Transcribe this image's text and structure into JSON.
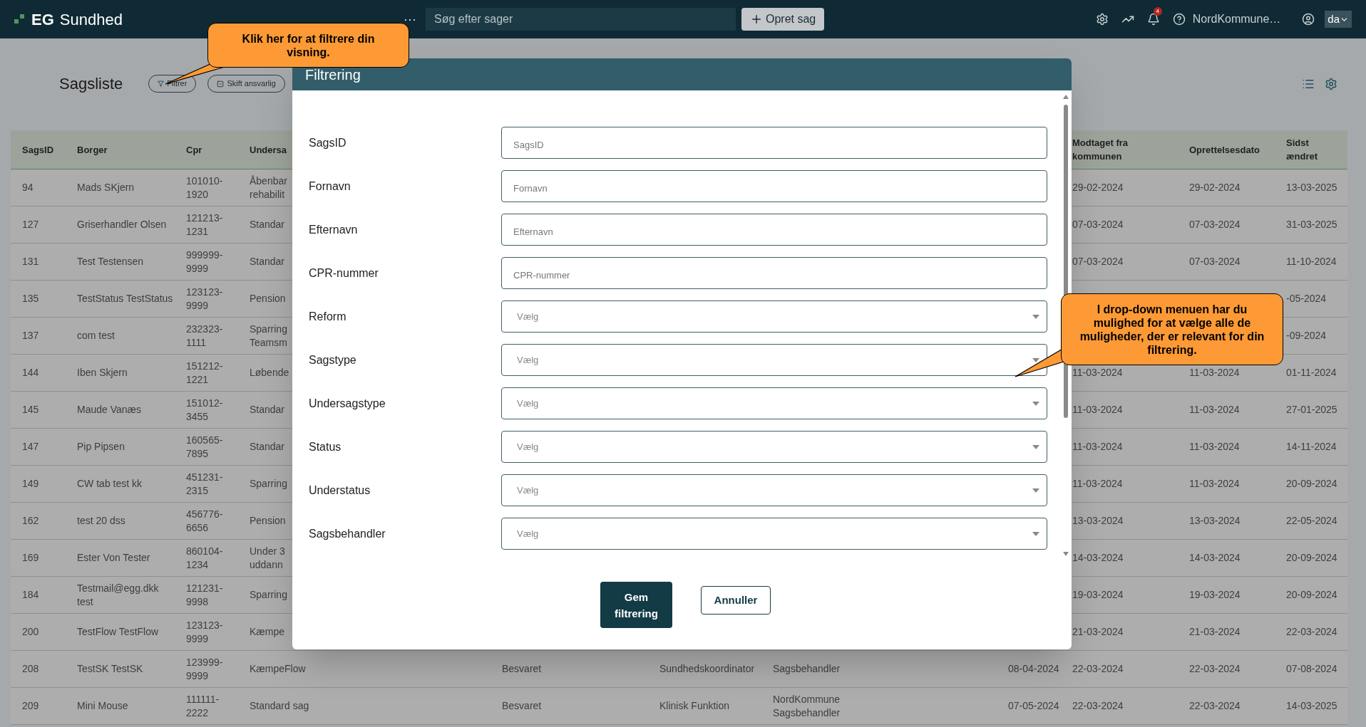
{
  "topbar": {
    "logo_mark": "EG",
    "logo_text": "Sundhed",
    "more": "⋯",
    "search_placeholder": "Søg efter sager",
    "create_button": "Opret sag",
    "notifications_badge": "4",
    "organization": "NordKommune…",
    "language": "da"
  },
  "page": {
    "title": "Sagsliste",
    "buttons": [
      {
        "label": "Filtrer"
      },
      {
        "label": "Skift ansvarlig"
      }
    ]
  },
  "table": {
    "columns": {
      "sagsid": "SagsID",
      "borger": "Borger",
      "cpr": "Cpr",
      "column_4": "Undersa",
      "modtaget": "Modtaget fra kommunen",
      "oprettelse": "Oprettelsesdato",
      "sidst": "Sidst ændret"
    },
    "rows": [
      {
        "sagsid": "94",
        "borger": "Mads SKjern",
        "cpr": "101010-1920",
        "column_4": "Åbenbar rehabilit",
        "modtaget": "29-02-2024",
        "oprettelse": "29-02-2024",
        "sidst": "13-03-2025"
      },
      {
        "sagsid": "127",
        "borger": "Griserhandler Olsen",
        "cpr": "121213-1231",
        "column_4": "Standar",
        "modtaget": "07-03-2024",
        "oprettelse": "07-03-2024",
        "sidst": "31-03-2025"
      },
      {
        "sagsid": "131",
        "borger": "Test Testensen",
        "cpr": "999999-9999",
        "column_4": "Standar",
        "modtaget": "07-03-2024",
        "oprettelse": "07-03-2024",
        "sidst": "11-10-2024"
      },
      {
        "sagsid": "135",
        "borger": "TestStatus TestStatus",
        "cpr": "123123-9999",
        "column_4": "Pension",
        "sidst": "-05-2024"
      },
      {
        "sagsid": "137",
        "borger": "com test",
        "cpr": "232323-1111",
        "column_4": "Sparring Teamsm",
        "sidst": "-09-2024"
      },
      {
        "sagsid": "144",
        "borger": "Iben Skjern",
        "cpr": "151212-1221",
        "column_4": "Løbende",
        "modtaget": "11-03-2024",
        "oprettelse": "11-03-2024",
        "sidst": "01-11-2024"
      },
      {
        "sagsid": "145",
        "borger": "Maude Vanæs",
        "cpr": "151012-3455",
        "column_4": "Standar",
        "modtaget": "11-03-2024",
        "oprettelse": "11-03-2024",
        "sidst": "27-01-2025"
      },
      {
        "sagsid": "147",
        "borger": "Pip Pipsen",
        "cpr": "160565-7895",
        "column_4": "Standar",
        "modtaget": "11-03-2024",
        "oprettelse": "11-03-2024",
        "sidst": "14-11-2024"
      },
      {
        "sagsid": "149",
        "borger": "CW tab test kk",
        "cpr": "451231-2315",
        "column_4": "Sparring",
        "modtaget": "11-03-2024",
        "oprettelse": "11-03-2024",
        "sidst": "20-09-2024"
      },
      {
        "sagsid": "162",
        "borger": "test 20 dss",
        "cpr": "456776-6656",
        "column_4": "Pension",
        "modtaget": "13-03-2024",
        "oprettelse": "13-03-2024",
        "sidst": "22-05-2024"
      },
      {
        "sagsid": "169",
        "borger": "Ester Von Tester",
        "cpr": "860104-1234",
        "column_4": "Under 3 uddann",
        "modtaget": "14-03-2024",
        "oprettelse": "14-03-2024",
        "sidst": "20-09-2024"
      },
      {
        "sagsid": "184",
        "borger": "Testmail@egg.dkk test",
        "cpr": "121231-9998",
        "column_4": "Sparring",
        "modtaget": "19-03-2024",
        "oprettelse": "19-03-2024",
        "sidst": "20-09-2024"
      },
      {
        "sagsid": "200",
        "borger": "TestFlow TestFlow",
        "cpr": "123123-9999",
        "column_4": "Kæmpe",
        "modtaget": "21-03-2024",
        "oprettelse": "21-03-2024",
        "sidst": "22-03-2024"
      },
      {
        "sagsid": "208",
        "borger": "TestSK TestSK",
        "cpr": "123999-9999",
        "column_4": "KæmpeFlow",
        "column_5": "Besvaret",
        "column_6": "Sundhedskoordinator",
        "column_7": "Sagsbehandler",
        "column_8": "08-04-2024",
        "modtaget": "22-03-2024",
        "oprettelse": "22-03-2024",
        "sidst": "07-08-2024"
      },
      {
        "sagsid": "209",
        "borger": "Mini Mouse",
        "cpr": "111111-2222",
        "column_4": "Standard sag",
        "column_5": "Besvaret",
        "column_6": "Klinisk Funktion",
        "column_7": "NordKommune Sagsbehandler",
        "column_8": "07-05-2024",
        "modtaget": "22-03-2024",
        "oprettelse": "22-03-2024",
        "sidst": "14-03-2025"
      }
    ]
  },
  "modal": {
    "title": "Filtrering",
    "fields": [
      {
        "kind": "text",
        "label": "SagsID",
        "placeholder": "SagsID"
      },
      {
        "kind": "text",
        "label": "Fornavn",
        "placeholder": "Fornavn"
      },
      {
        "kind": "text",
        "label": "Efternavn",
        "placeholder": "Efternavn"
      },
      {
        "kind": "text",
        "label": "CPR-nummer",
        "placeholder": "CPR-nummer"
      },
      {
        "kind": "select",
        "label": "Reform",
        "placeholder": "Vælg"
      },
      {
        "kind": "select",
        "label": "Sagstype",
        "placeholder": "Vælg"
      },
      {
        "kind": "select",
        "label": "Undersagstype",
        "placeholder": "Vælg"
      },
      {
        "kind": "select",
        "label": "Status",
        "placeholder": "Vælg"
      },
      {
        "kind": "select",
        "label": "Understatus",
        "placeholder": "Vælg"
      },
      {
        "kind": "select",
        "label": "Sagsbehandler",
        "placeholder": "Vælg"
      }
    ],
    "buttons": [
      {
        "kind": "primary",
        "label": "Gem filtrering"
      },
      {
        "kind": "secondary",
        "label": "Annuller"
      }
    ]
  },
  "callouts": [
    {
      "text": "Klik her for at filtrere din visning."
    },
    {
      "text": "I drop-down menuen har du mulighed for at vælge alle de muligheder, der er relevant for din filtrering."
    }
  ]
}
